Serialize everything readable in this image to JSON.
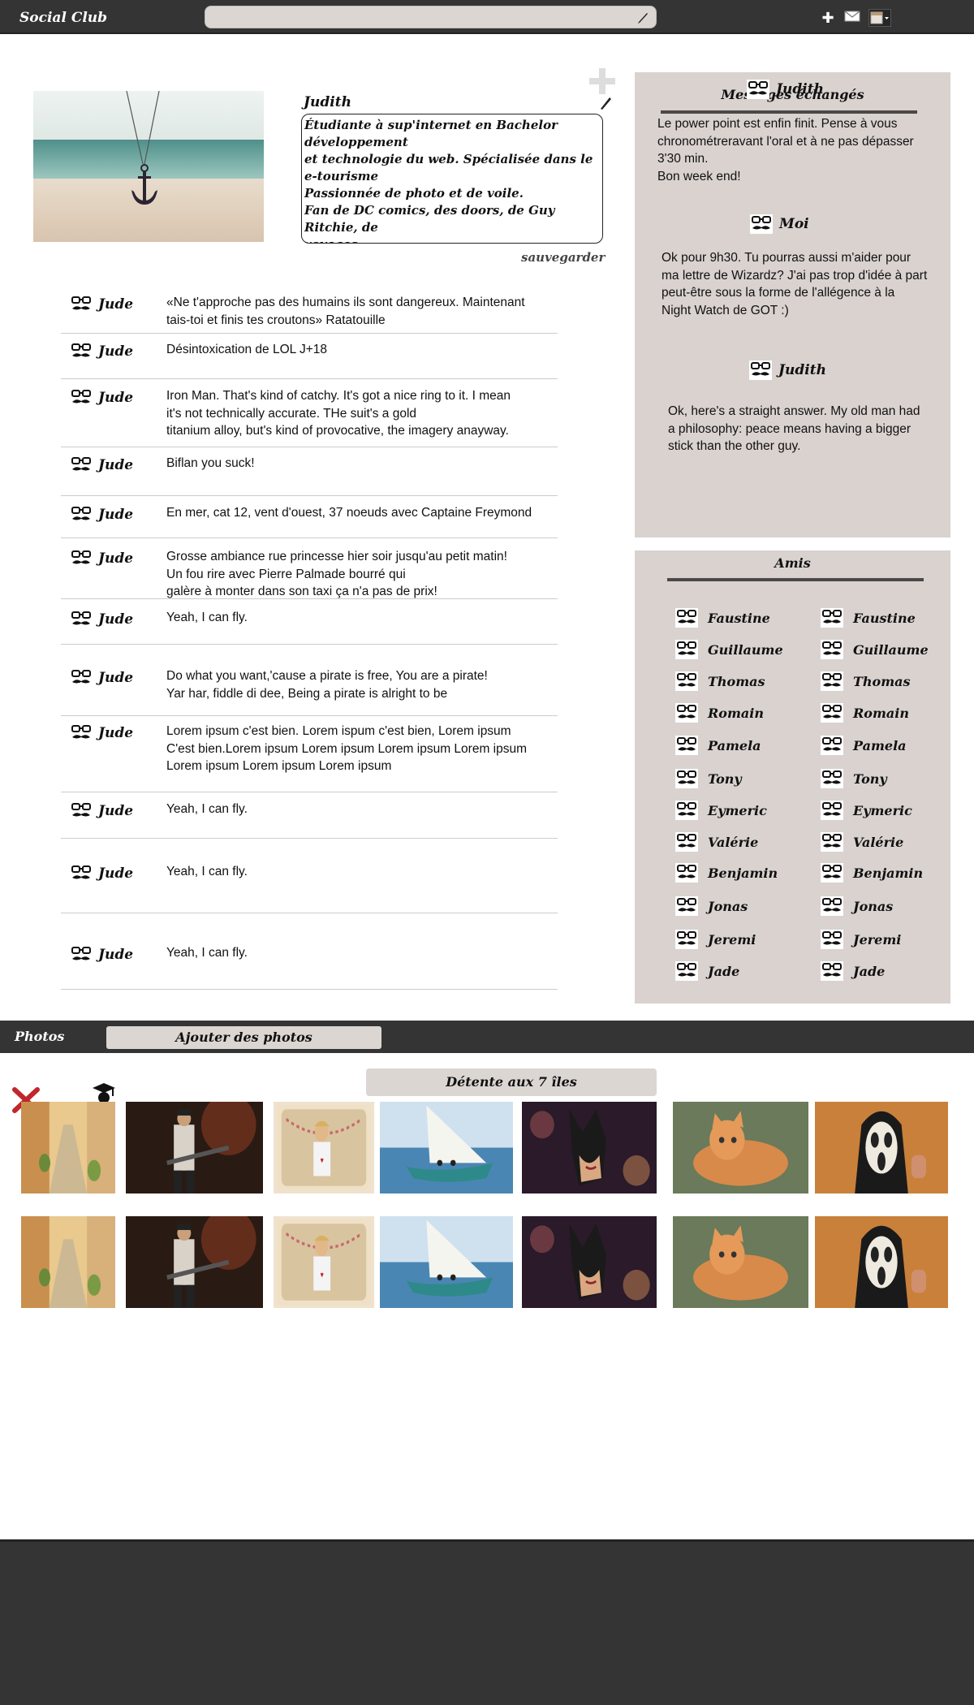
{
  "app": {
    "title": "Social Club"
  },
  "search": {
    "placeholder": ""
  },
  "profile": {
    "name": "Judith",
    "bio": "Étudiante à sup'internet en Bachelor développement\net technologie du web.  Spécialisée dans le e-tourisme\nPassionnée de photo et de voile.\nFan de DC comics, des doors, de Guy Ritchie, de\nvoyages.",
    "save_label": "sauvegarder"
  },
  "feed": [
    {
      "user": "Jude",
      "text": "«Ne t'approche pas des humains ils sont dangereux. Maintenant\n tais-toi et finis tes croutons» Ratatouille"
    },
    {
      "user": "Jude",
      "text": "Désintoxication de LOL J+18"
    },
    {
      "user": "Jude",
      "text": "Iron Man. That's kind of catchy. It's got a nice ring to it. I mean\n it's not technically accurate. THe suit's a gold\ntitanium alloy, but's kind of provocative, the imagery anayway."
    },
    {
      "user": "Jude",
      "text": "Biflan you suck!"
    },
    {
      "user": "Jude",
      "text": "En mer, cat 12, vent d'ouest, 37 noeuds avec Captaine Freymond"
    },
    {
      "user": "Jude",
      "text": "Grosse ambiance rue princesse hier soir jusqu'au petit matin!\nUn fou rire avec Pierre Palmade bourré qui\ngalère à monter dans son taxi ça n'a pas de prix!"
    },
    {
      "user": "Jude",
      "text": "Yeah, I can fly."
    },
    {
      "user": "Jude",
      "text": "Do what you want,'cause a pirate is free, You are a pirate!\nYar har, fiddle di dee, Being a pirate is alright to be"
    },
    {
      "user": "Jude",
      "text": "Lorem ipsum c'est bien. Lorem ispum c'est bien, Lorem ipsum\nC'est bien.Lorem ipsum Lorem ipsum Lorem ipsum Lorem ipsum\nLorem ipsum Lorem ipsum Lorem ipsum"
    },
    {
      "user": "Jude",
      "text": "Yeah, I can fly."
    },
    {
      "user": "Jude",
      "text": "Yeah, I can fly."
    },
    {
      "user": "Jude",
      "text": "Yeah, I can fly."
    }
  ],
  "messages": {
    "title": "Messages échangés",
    "items": [
      {
        "from": "Judith",
        "text": "Le power point est enfin finit. Pense à vous\nchronométreravant l'oral et à ne pas dépasser\n3'30 min.\nBon week end!"
      },
      {
        "from": "Moi",
        "text": "Ok pour 9h30. Tu pourras aussi m'aider pour\nma lettre de Wizardz? J'ai pas trop d'idée à part\n peut-être sous la forme de l'allégence à la\nNight Watch de GOT :)"
      },
      {
        "from": "Judith",
        "text": "Ok, here's a straight answer. My old man had\na philosophy: peace means having a bigger\nstick than the other guy."
      }
    ]
  },
  "friends": {
    "title": "Amis",
    "left": [
      "Faustine",
      "Guillaume",
      "Thomas",
      "Romain",
      "Pamela",
      "Tony",
      "Eymeric",
      "Valérie",
      "Benjamin",
      "Jonas",
      "Jeremi",
      "Jade"
    ],
    "right": [
      "Faustine",
      "Guillaume",
      "Thomas",
      "Romain",
      "Pamela",
      "Tony",
      "Eymeric",
      "Valérie",
      "Benjamin",
      "Jonas",
      "Jeremi",
      "Jade"
    ]
  },
  "photos": {
    "label": "Photos",
    "add_label": "Ajouter des photos",
    "album_title": "Détente aux 7 îles",
    "items": [
      "alley",
      "guitarist",
      "ny-girl",
      "sailboat",
      "catwoman",
      "cat",
      "scream-mask"
    ]
  },
  "colors": {
    "bar": "#343434",
    "panel": "#d9d2cf",
    "input": "#dcd6d3",
    "rule": "#4b4848"
  }
}
